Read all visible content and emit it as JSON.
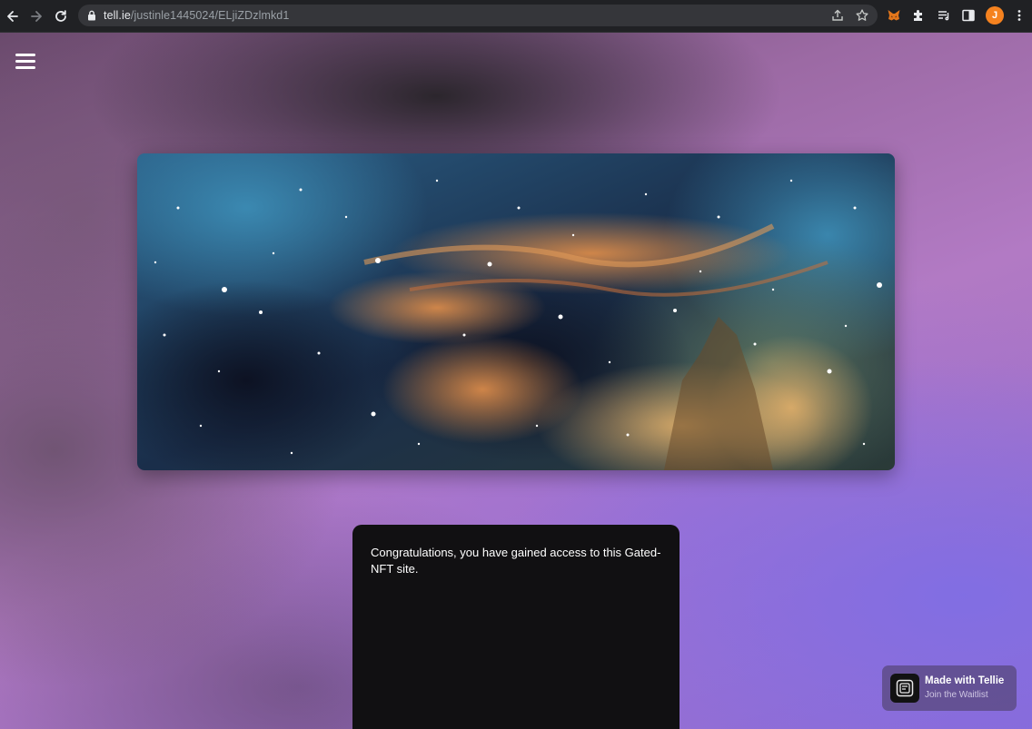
{
  "browser": {
    "url_host": "tell.ie",
    "url_path": "/justinle1445024/ELjiZDzlmkd1",
    "profile_initial": "J",
    "icons": [
      "back-icon",
      "forward-icon",
      "reload-icon",
      "lock-icon",
      "share-icon",
      "bookmark-star-icon",
      "metamask-fox-icon",
      "extensions-puzzle-icon",
      "reading-list-icon",
      "side-panel-icon",
      "kebab-menu-icon"
    ],
    "colors": {
      "toolbar": "#202124",
      "omnibox": "#35363a",
      "avatar": "#f5821f"
    }
  },
  "page": {
    "menu_icon": "hamburger-menu-icon",
    "banner_image": "nebula-space-image",
    "card_message": "Congratulations, you have gained access to this Gated-NFT site.",
    "badge": {
      "title": "Made with Tellie",
      "subtitle": "Join the Waitlist",
      "icon": "tellie-logo-icon"
    },
    "colors": {
      "card_bg": "#111012",
      "badge_bg": "#564678"
    }
  }
}
